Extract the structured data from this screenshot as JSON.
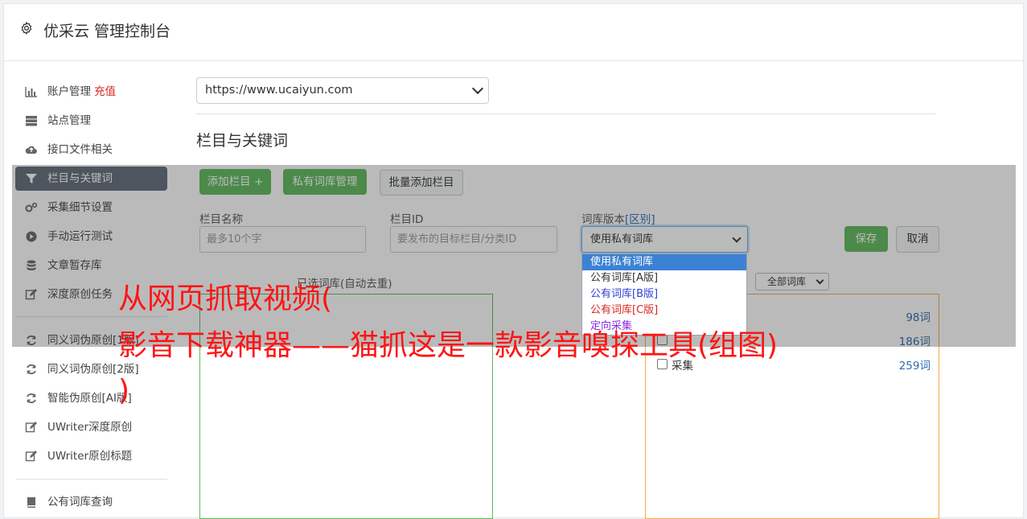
{
  "app": {
    "title": "优采云 管理控制台"
  },
  "sidebar": {
    "items": [
      {
        "label": "账户管理",
        "badge": "充值",
        "icon": "bar-chart-icon"
      },
      {
        "label": "站点管理",
        "icon": "server-icon"
      },
      {
        "label": "接口文件相关",
        "icon": "cloud-upload-icon"
      },
      {
        "label": "栏目与关键词",
        "icon": "filter-icon",
        "active": true
      },
      {
        "label": "采集细节设置",
        "icon": "gears-icon"
      },
      {
        "label": "手动运行测试",
        "icon": "play-circle-icon"
      },
      {
        "label": "文章暂存库",
        "icon": "database-icon"
      },
      {
        "label": "深度原创任务",
        "icon": "edit-icon"
      },
      {
        "label": "同义词伪原创[1版]",
        "icon": "refresh-icon"
      },
      {
        "label": "同义词伪原创[2版]",
        "icon": "refresh-icon"
      },
      {
        "label": "智能伪原创[AI版]",
        "icon": "refresh-icon"
      },
      {
        "label": "UWriter深度原创",
        "icon": "edit-icon"
      },
      {
        "label": "UWriter原创标题",
        "icon": "edit-icon"
      },
      {
        "label": "公有词库查询",
        "icon": "book-icon"
      }
    ]
  },
  "main": {
    "site_select": {
      "value": "https://www.ucaiyun.com"
    },
    "section_title": "栏目与关键词",
    "buttons": {
      "add_column": "添加栏目 +",
      "private_lib": "私有词库管理",
      "batch_add": "批量添加栏目",
      "save": "保存",
      "cancel": "取消"
    },
    "form": {
      "name_label": "栏目名称",
      "name_placeholder": "最多10个字",
      "id_label": "栏目ID",
      "id_placeholder": "要发布的目标栏目/分类ID",
      "lib_label": "词库版本",
      "lib_label_link": "[区别]",
      "lib_value": "使用私有词库"
    },
    "dropdown": {
      "options": [
        {
          "label": "使用私有词库",
          "color": "#ffffff",
          "selected": true
        },
        {
          "label": "公有词库[A版]",
          "color": "#333333"
        },
        {
          "label": "公有词库[B版]",
          "color": "#2f3fd6"
        },
        {
          "label": "公有词库[C版]",
          "color": "#d9251d"
        },
        {
          "label": "定向采集",
          "color": "#8a2be2"
        }
      ]
    },
    "selected_panel": {
      "title": "已选词库(自动去重)"
    },
    "lib_panel": {
      "filter_value": "全部词库",
      "rows": [
        {
          "name": "",
          "count": "98词"
        },
        {
          "name": "",
          "count": "186词"
        },
        {
          "name": "采集",
          "count": "259词"
        }
      ]
    }
  },
  "watermark": {
    "line1": "从网页抓取视频(",
    "line2": "影音下载神器——猫抓这是一款影音嗅探工具(组图)",
    "line3": ")"
  }
}
